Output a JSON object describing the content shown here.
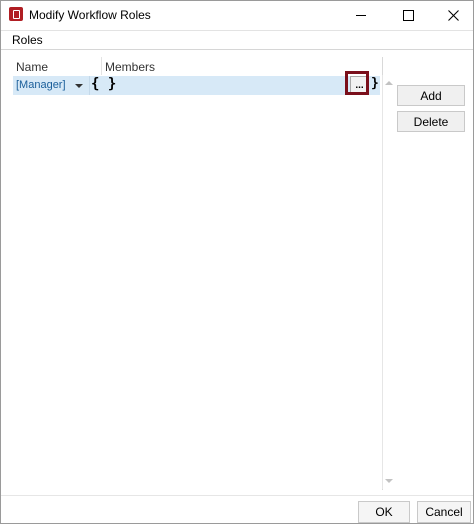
{
  "window": {
    "title": "Modify Workflow Roles"
  },
  "group": {
    "label": "Roles"
  },
  "grid": {
    "columns": [
      "Name",
      "Members"
    ],
    "rows": [
      {
        "name": "[Manager]",
        "members": ""
      }
    ],
    "braces_text": "{ }",
    "ellipsis_label": "...",
    "close_brace": "}"
  },
  "side_buttons": {
    "add_label": "Add",
    "delete_label": "Delete"
  },
  "footer": {
    "ok_label": "OK",
    "cancel_label": "Cancel"
  },
  "colors": {
    "selected_row": "#d7e9f7",
    "highlight": "#7a0f1b",
    "app_icon": "#b01e23"
  }
}
